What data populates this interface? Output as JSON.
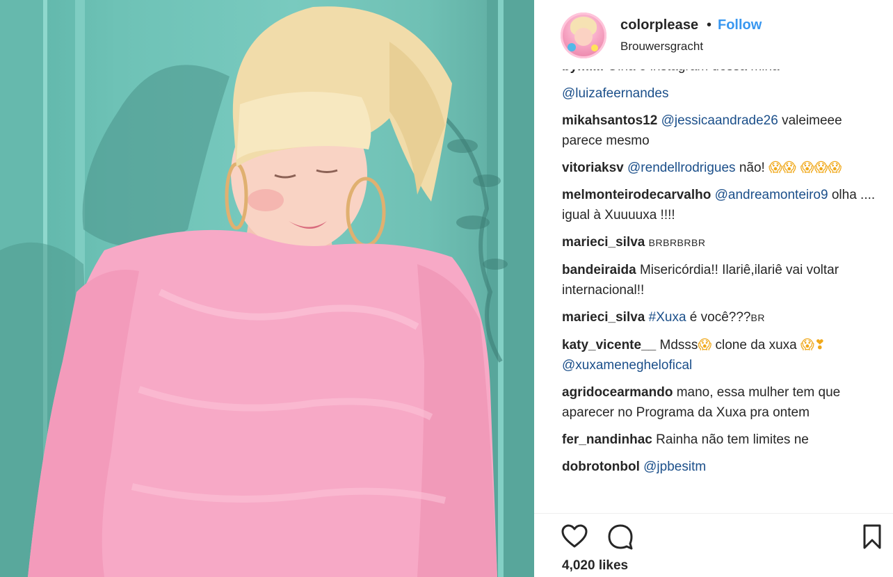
{
  "post": {
    "username": "colorplease",
    "separator": "•",
    "follow_label": "Follow",
    "location": "Brouwersgracht",
    "likes": "4,020 likes"
  },
  "comments": [
    {
      "user": "bymilli",
      "parts": [
        {
          "t": "text",
          "v": "Olha o instagram dessa mina"
        }
      ]
    },
    {
      "user": "",
      "parts": [
        {
          "t": "mention",
          "v": "@luizafeernandes"
        }
      ]
    },
    {
      "user": "mikahsantos12",
      "parts": [
        {
          "t": "mention",
          "v": "@jessicaandrade26"
        },
        {
          "t": "text",
          "v": " valeimeee parece mesmo"
        }
      ]
    },
    {
      "user": "vitoriaksv",
      "parts": [
        {
          "t": "mention",
          "v": "@rendellrodrigues"
        },
        {
          "t": "text",
          "v": " não! "
        },
        {
          "t": "emoji",
          "v": "😱😱 😱😱😱"
        }
      ]
    },
    {
      "user": "melmonteirodecarvalho",
      "parts": [
        {
          "t": "mention",
          "v": "@andreamonteiro9"
        },
        {
          "t": "text",
          "v": " olha .... igual à Xuuuuxa !!!!"
        }
      ]
    },
    {
      "user": "marieci_silva",
      "parts": [
        {
          "t": "small",
          "v": "BRBRBRBR"
        }
      ]
    },
    {
      "user": "bandeiraida",
      "parts": [
        {
          "t": "text",
          "v": "Misericórdia!! Ilariê,ilariê vai voltar internacional!!"
        }
      ]
    },
    {
      "user": "marieci_silva",
      "parts": [
        {
          "t": "mention",
          "v": "#Xuxa"
        },
        {
          "t": "text",
          "v": " é você???"
        },
        {
          "t": "small",
          "v": "BR"
        }
      ]
    },
    {
      "user": "katy_vicente__",
      "parts": [
        {
          "t": "text",
          "v": "Mdsss"
        },
        {
          "t": "emoji",
          "v": "😱"
        },
        {
          "t": "text",
          "v": " clone da xuxa "
        },
        {
          "t": "emoji",
          "v": "😱❣"
        },
        {
          "t": "text",
          "v": " "
        },
        {
          "t": "mention",
          "v": "@xuxameneghelofical"
        }
      ]
    },
    {
      "user": "agridocearmando",
      "parts": [
        {
          "t": "text",
          "v": "mano, essa mulher tem que aparecer no Programa da Xuxa pra ontem"
        }
      ]
    },
    {
      "user": "fer_nandinhac",
      "parts": [
        {
          "t": "text",
          "v": "Rainha não tem limites ne"
        }
      ]
    },
    {
      "user": "dobrotonbol",
      "parts": [
        {
          "t": "mention",
          "v": "@jpbesitm"
        }
      ]
    }
  ],
  "icons": {
    "like": "heart-outline-icon",
    "comment": "speech-bubble-icon",
    "save": "bookmark-icon"
  },
  "colors": {
    "follow": "#3897f0",
    "mention": "#1b4f8a",
    "wall": "#6ec2b6",
    "sweater": "#f7a9c6"
  }
}
